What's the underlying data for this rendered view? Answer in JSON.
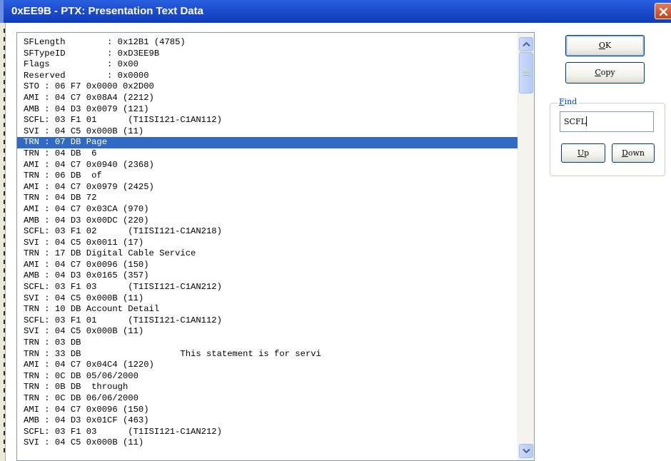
{
  "window": {
    "title": "0xEE9B - PTX: Presentation Text Data"
  },
  "list": {
    "selected_index": 9,
    "rows": [
      "SFLength        : 0x12B1 (4785)",
      "SFTypeID        : 0xD3EE9B",
      "Flags           : 0x00",
      "Reserved        : 0x0000",
      "STO : 06 F7 0x0000 0x2D00",
      "AMI : 04 C7 0x08A4 (2212)",
      "AMB : 04 D3 0x0079 (121)",
      "SCFL: 03 F1 01      (T1ISI121-C1AN112)",
      "SVI : 04 C5 0x000B (11)",
      "TRN : 07 DB Page",
      "TRN : 04 DB  6",
      "AMI : 04 C7 0x0940 (2368)",
      "TRN : 06 DB  of",
      "AMI : 04 C7 0x0979 (2425)",
      "TRN : 04 DB 72",
      "AMI : 04 C7 0x03CA (970)",
      "AMB : 04 D3 0x00DC (220)",
      "SCFL: 03 F1 02      (T1ISI121-C1AN218)",
      "SVI : 04 C5 0x0011 (17)",
      "TRN : 17 DB Digital Cable Service",
      "AMI : 04 C7 0x0096 (150)",
      "AMB : 04 D3 0x0165 (357)",
      "SCFL: 03 F1 03      (T1ISI121-C1AN212)",
      "SVI : 04 C5 0x000B (11)",
      "TRN : 10 DB Account Detail",
      "SCFL: 03 F1 01      (T1ISI121-C1AN112)",
      "SVI : 04 C5 0x000B (11)",
      "TRN : 03 DB",
      "TRN : 33 DB                   This statement is for servi",
      "AMI : 04 C7 0x04C4 (1220)",
      "TRN : 0C DB 05/06/2000",
      "TRN : 0B DB  through",
      "TRN : 0C DB 06/06/2000",
      "AMI : 04 C7 0x0096 (150)",
      "AMB : 04 D3 0x01CF (463)",
      "SCFL: 03 F1 03      (T1ISI121-C1AN212)",
      "SVI : 04 C5 0x000B (11)"
    ]
  },
  "buttons": {
    "ok": "OK",
    "copy": "Copy",
    "up": "Up",
    "down": "Down"
  },
  "find": {
    "label": "Find",
    "value": "SCFL"
  },
  "icons": {
    "close": "close-icon",
    "scroll_up": "chevron-up-icon",
    "scroll_down": "chevron-down-icon"
  },
  "colors": {
    "titlebar": "#1e4fd1",
    "selection": "#316ac5",
    "find_label": "#0046d5",
    "close": "#d9542b"
  }
}
